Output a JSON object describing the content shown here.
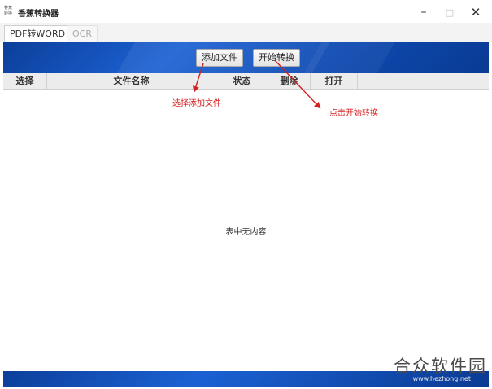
{
  "window": {
    "icon_text": [
      "香",
      "蕉",
      "转",
      "换"
    ],
    "title": "香蕉转换器",
    "min_symbol": "–",
    "max_symbol": "□",
    "close_symbol": "✕"
  },
  "tabs": [
    {
      "label": "PDF转WORD",
      "active": true
    },
    {
      "label": "OCR",
      "active": false
    }
  ],
  "toolbar": {
    "add_label": "添加文件",
    "start_label": "开始转换"
  },
  "table": {
    "columns": [
      "选择",
      "文件名称",
      "状态",
      "删除",
      "打开"
    ],
    "empty_text": "表中无内容"
  },
  "annotations": {
    "add_hint": "选择添加文件",
    "start_hint": "点击开始转换",
    "color": "#d42020"
  },
  "watermark": {
    "main": "合众软件园",
    "sub": "www.hezhong.net"
  },
  "colors": {
    "banner_blue": "#1b61d3"
  }
}
